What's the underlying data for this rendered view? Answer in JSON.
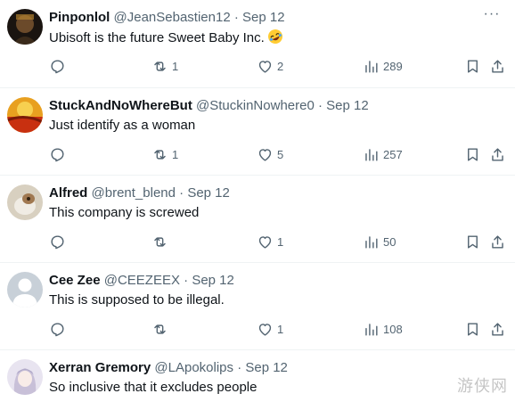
{
  "tweets": [
    {
      "name": "Pinponlol",
      "handle": "@JeanSebastien12",
      "separator": "·",
      "date": "Sep 12",
      "text": "Ubisoft is the future Sweet Baby Inc.",
      "emoji": "rolling-on-floor-laughing-emoji",
      "replies": "",
      "retweets": "1",
      "likes": "2",
      "views": "289"
    },
    {
      "name": "StuckAndNoWhereBut",
      "handle": "@StuckinNowhere0",
      "separator": "·",
      "date": "Sep 12",
      "text": "Just identify as a woman",
      "replies": "",
      "retweets": "1",
      "likes": "5",
      "views": "257"
    },
    {
      "name": "Alfred",
      "handle": "@brent_blend",
      "separator": "·",
      "date": "Sep 12",
      "text": "This company is screwed",
      "replies": "",
      "retweets": "",
      "likes": "1",
      "views": "50"
    },
    {
      "name": "Cee Zee",
      "handle": "@CEEZEEX",
      "separator": "·",
      "date": "Sep 12",
      "text": "This is supposed to be illegal.",
      "replies": "",
      "retweets": "",
      "likes": "1",
      "views": "108"
    },
    {
      "name": "Xerran Gremory",
      "handle": "@LApokolips",
      "separator": "·",
      "date": "Sep 12",
      "text": "So inclusive that it excludes people"
    }
  ],
  "more_label": "···",
  "watermark": "游侠网",
  "colors": {
    "text": "#0f1419",
    "secondary": "#536471",
    "border": "#eff3f4"
  }
}
